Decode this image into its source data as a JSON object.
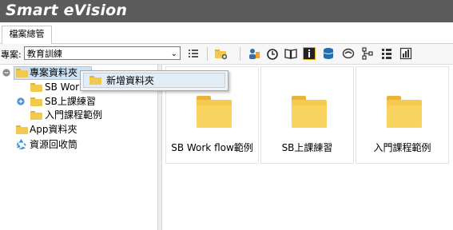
{
  "app": {
    "title": "Smart eVision"
  },
  "tabs": [
    {
      "label": "檔案總管"
    }
  ],
  "toolbar": {
    "project_label": "專案:",
    "project_value": "教育訓練"
  },
  "tree": {
    "root": {
      "label": "專案資料夾"
    },
    "children": [
      {
        "label": "SB Work flow範例"
      },
      {
        "label": "SB上課練習"
      },
      {
        "label": "入門課程範例"
      }
    ],
    "app_folder": {
      "label": "App資料夾"
    },
    "recycle": {
      "label": "資源回收筒"
    }
  },
  "context_menu": {
    "items": [
      {
        "label": "新增資料夾"
      }
    ]
  },
  "cards": [
    {
      "label": "SB Work flow範例"
    },
    {
      "label": "SB上課練習"
    },
    {
      "label": "入門課程範例"
    }
  ],
  "colors": {
    "titlebar": "#5b5b5b",
    "folder": "#f6c94f",
    "selection": "#cde4f7"
  }
}
